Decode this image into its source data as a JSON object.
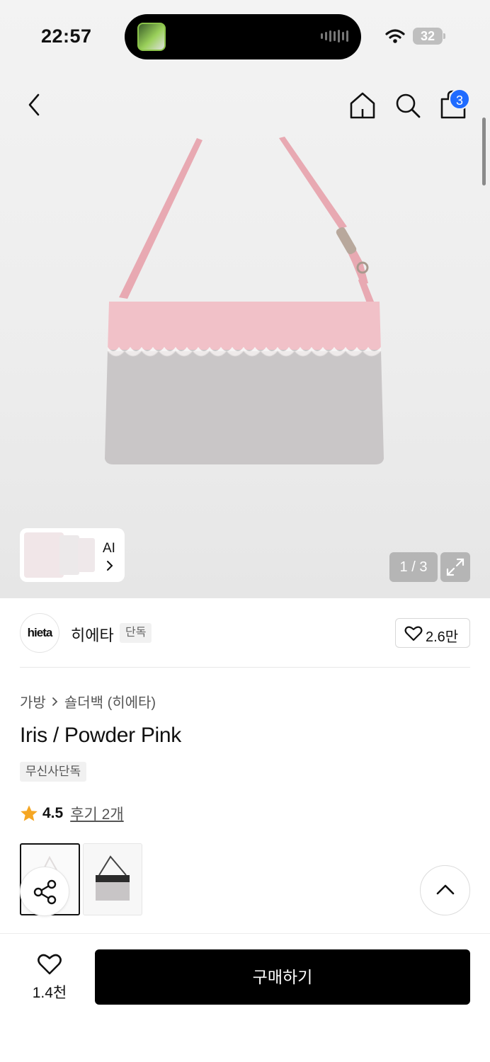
{
  "status_bar": {
    "time": "22:57",
    "battery": "32"
  },
  "header": {
    "cart_badge": "3"
  },
  "gallery": {
    "ai_label": "AI",
    "counter": "1 / 3"
  },
  "brand": {
    "logo_text": "hieta",
    "name": "히에타",
    "tag": "단독",
    "favorite_count": "2.6만"
  },
  "breadcrumb": {
    "category": "가방",
    "subcategory": "숄더백 (히에타)"
  },
  "product": {
    "title": "Iris / Powder Pink",
    "exclusive_tag": "무신사단독",
    "rating": "4.5",
    "review_link": "후기 2개"
  },
  "bottom_bar": {
    "like_count": "1.4천",
    "buy_label": "구매하기"
  },
  "colors": {
    "accent_blue": "#1f6bff",
    "star": "#f5a623",
    "buy_bg": "#000000",
    "bag_pink": "#f1c1c8",
    "bag_grey": "#c9c6c7"
  },
  "icons": [
    "back-icon",
    "home-icon",
    "search-icon",
    "cart-icon",
    "heart-icon",
    "share-icon",
    "chevron-up-icon",
    "expand-icon",
    "star-icon",
    "wifi-icon"
  ]
}
